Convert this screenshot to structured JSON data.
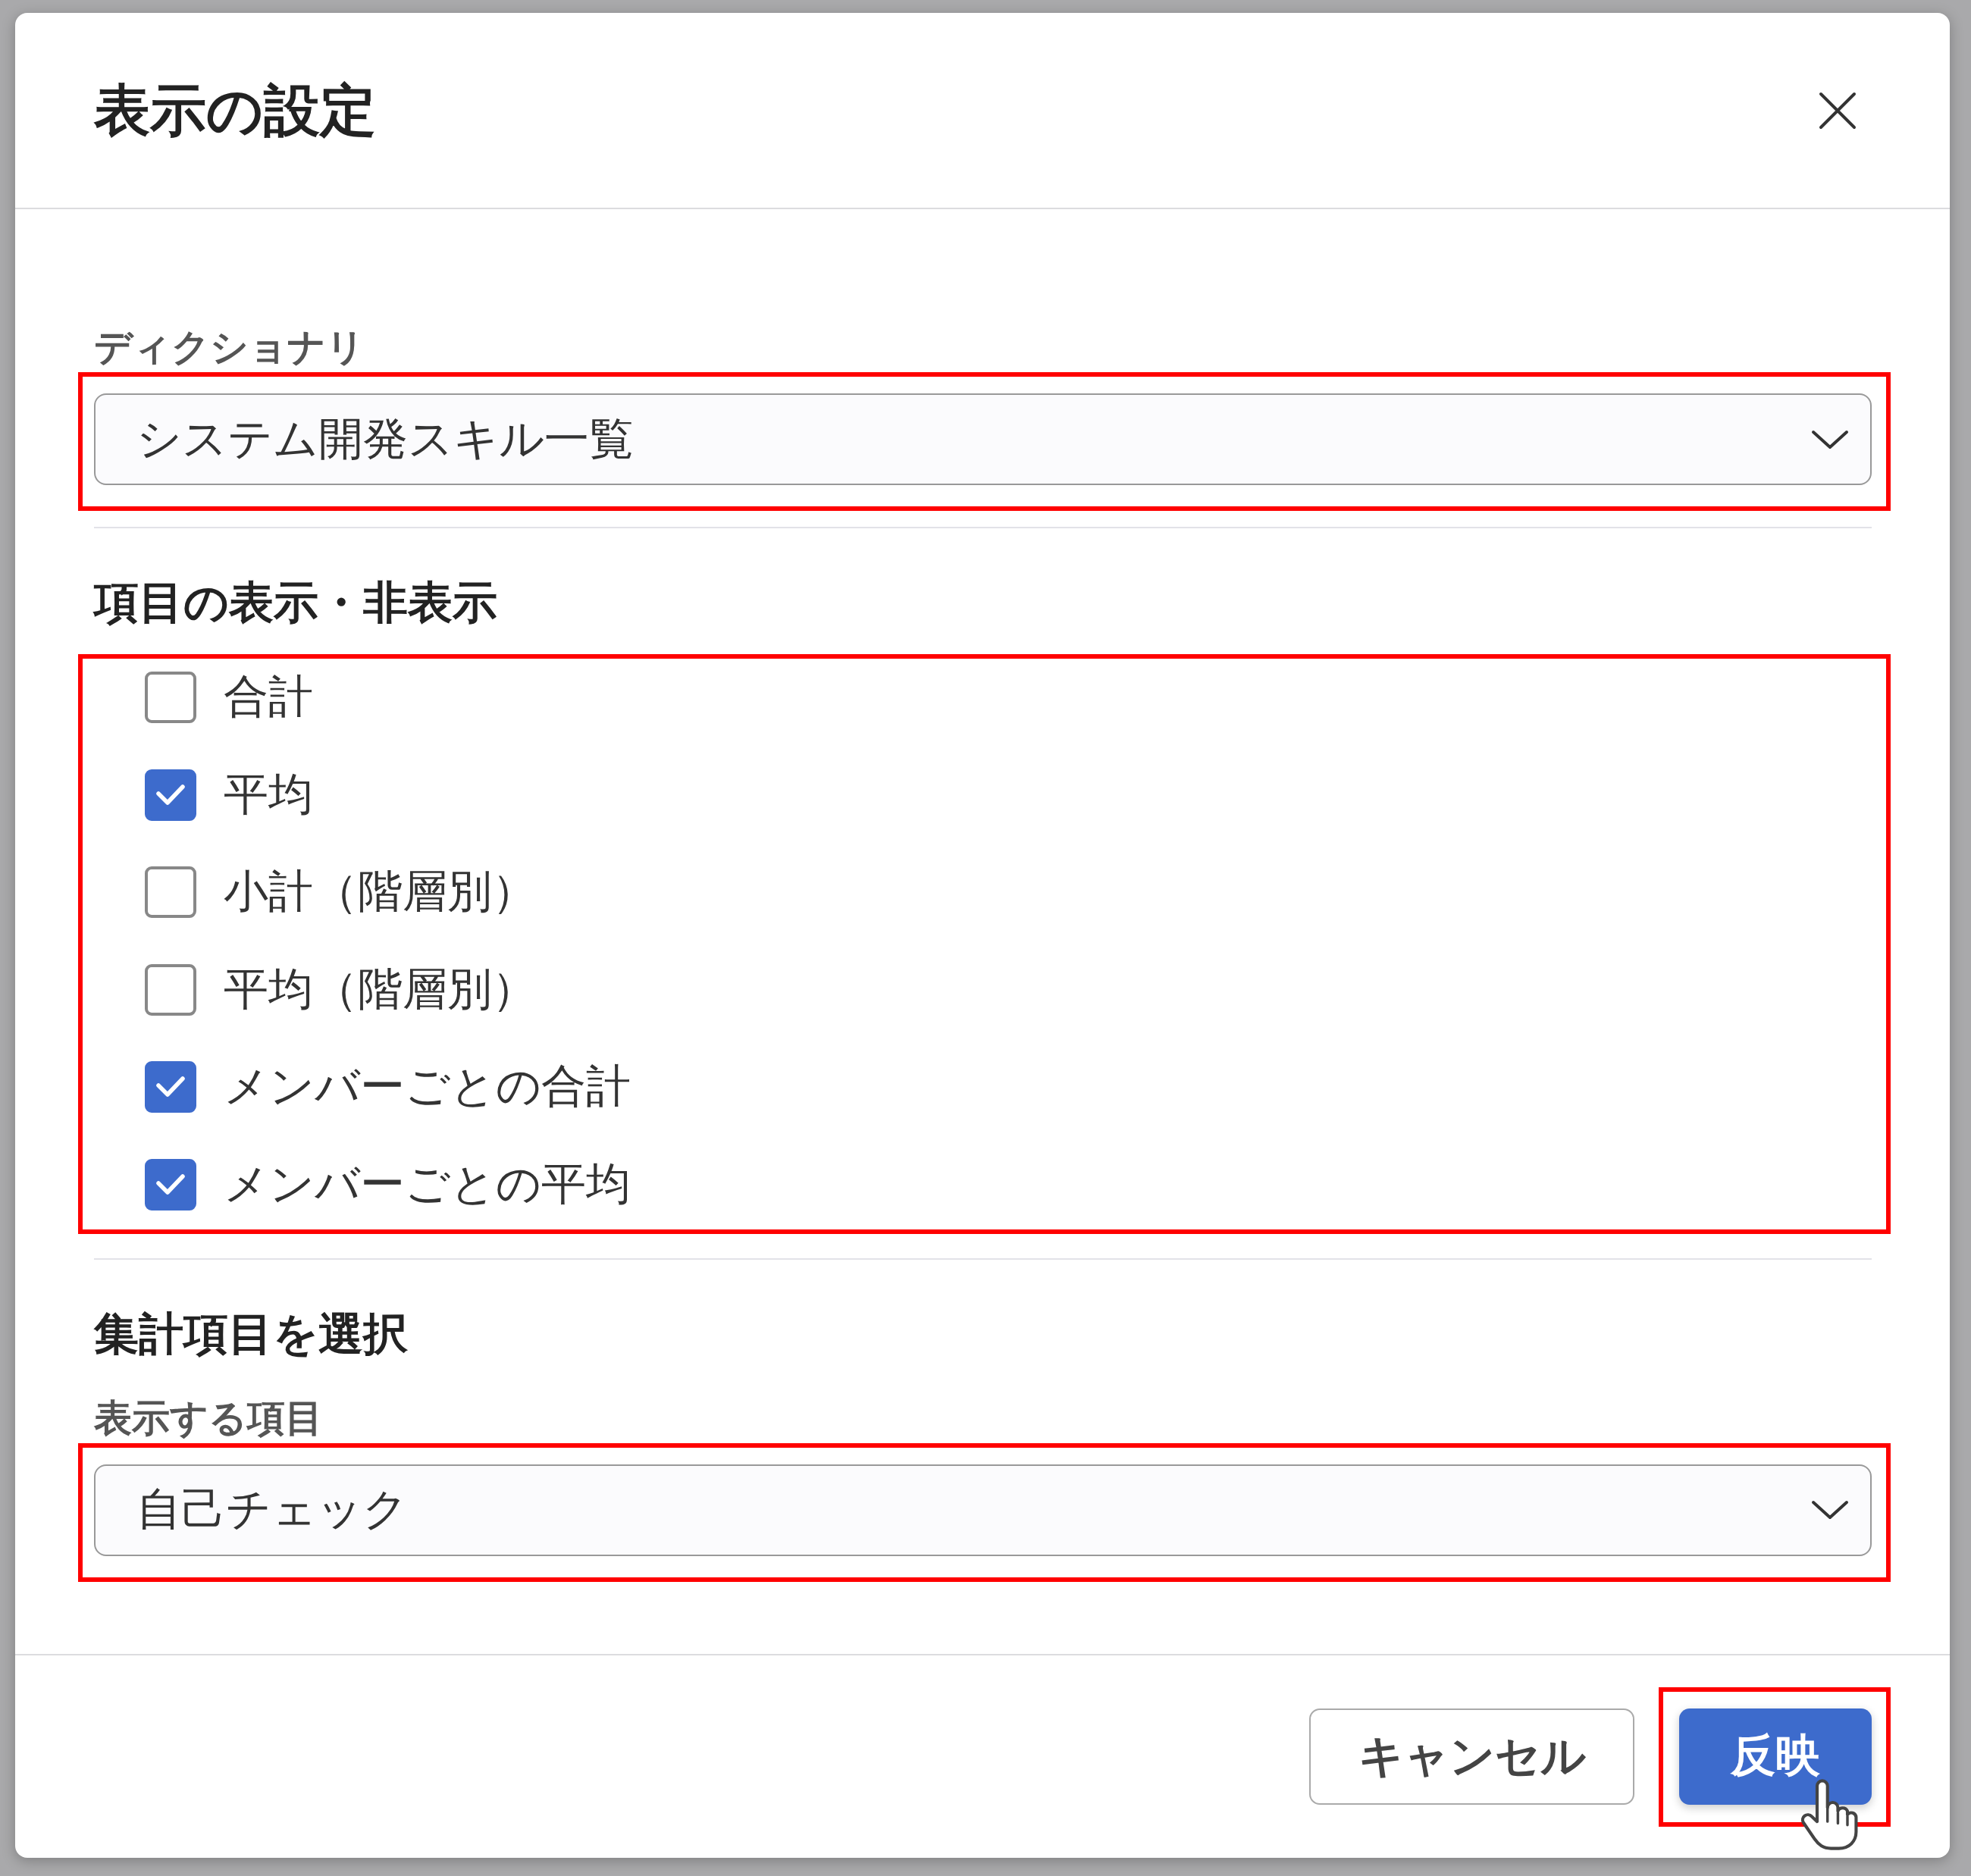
{
  "dialog": {
    "title": "表示の設定"
  },
  "dictionary": {
    "label": "ディクショナリ",
    "value": "システム開発スキル一覧",
    "highlighted": true
  },
  "visibility": {
    "heading": "項目の表示・非表示",
    "highlighted": true,
    "items": [
      {
        "label": "合計",
        "checked": false
      },
      {
        "label": "平均",
        "checked": true
      },
      {
        "label": "小計（階層別）",
        "checked": false
      },
      {
        "label": "平均（階層別）",
        "checked": false
      },
      {
        "label": "メンバーごとの合計",
        "checked": true
      },
      {
        "label": "メンバーごとの平均",
        "checked": true
      }
    ]
  },
  "aggregation": {
    "heading": "集計項目を選択",
    "label": "表示する項目",
    "value": "自己チェック",
    "highlighted": true
  },
  "buttons": [
    {
      "label": "キャンセル",
      "kind": "secondary",
      "highlighted": false,
      "hovered": false
    },
    {
      "label": "反映",
      "kind": "primary",
      "highlighted": true,
      "hovered": true
    }
  ]
}
